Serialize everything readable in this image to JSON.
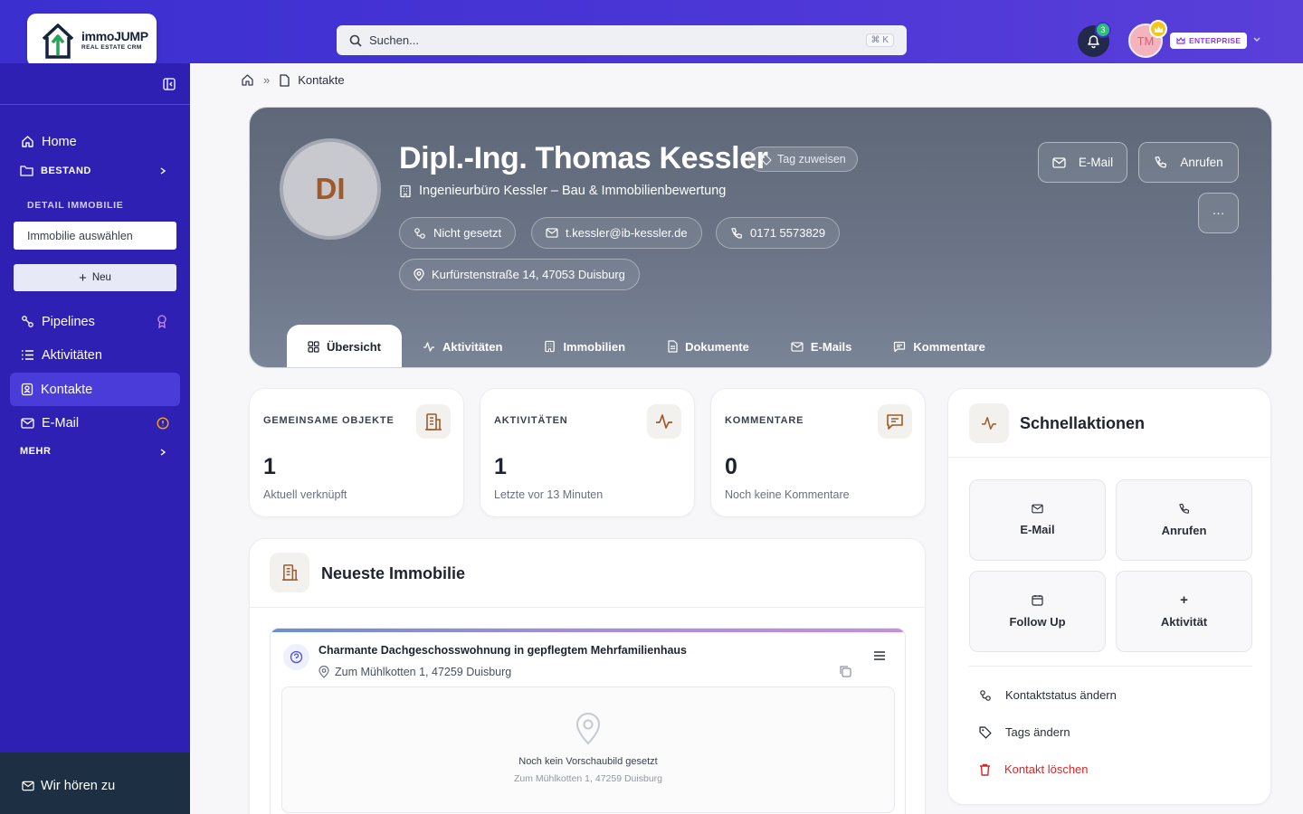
{
  "brand": {
    "name": "immoJUMP",
    "tagline": "REAL ESTATE CRM"
  },
  "search": {
    "placeholder": "Suchen...",
    "shortcut": "⌘ K"
  },
  "header": {
    "notification_count": "3",
    "user_initials": "TM",
    "plan_badge": "ENTERPRISE"
  },
  "sidebar": {
    "home": "Home",
    "bestand": "BESTAND",
    "detail_heading": "DETAIL IMMOBILIE",
    "select_placeholder": "Immobilie auswählen",
    "new_label": "Neu",
    "pipelines": "Pipelines",
    "aktivitaeten": "Aktivitäten",
    "kontakte": "Kontakte",
    "email": "E-Mail",
    "mehr": "MEHR",
    "feedback": "Wir hören zu"
  },
  "breadcrumb": {
    "current": "Kontakte"
  },
  "contact": {
    "initials": "DI",
    "name": "Dipl.-Ing. Thomas Kessler",
    "tag_button": "Tag zuweisen",
    "company": "Ingenieurbüro Kessler – Bau & Immobilienbewertung",
    "status": "Nicht gesetzt",
    "email": "t.kessler@ib-kessler.de",
    "phone": "0171 5573829",
    "address": "Kurfürstenstraße 14, 47053 Duisburg",
    "btn_email": "E-Mail",
    "btn_call": "Anrufen",
    "btn_more": "···"
  },
  "tabs": [
    "Übersicht",
    "Aktivitäten",
    "Immobilien",
    "Dokumente",
    "E-Mails",
    "Kommentare"
  ],
  "stats": [
    {
      "label": "GEMEINSAME OBJEKTE",
      "value": "1",
      "sub": "Aktuell verknüpft"
    },
    {
      "label": "AKTIVITÄTEN",
      "value": "1",
      "sub": "Letzte vor 13 Minuten"
    },
    {
      "label": "KOMMENTARE",
      "value": "0",
      "sub": "Noch keine Kommentare"
    }
  ],
  "latest_property": {
    "section_title": "Neueste Immobilie",
    "title": "Charmante Dachgeschosswohnung in gepflegtem Mehrfamilienhaus",
    "address": "Zum Mühlkotten 1, 47259 Duisburg",
    "no_image": "Noch kein Vorschaubild gesetzt",
    "no_image_addr": "Zum Mühlkotten 1, 47259 Duisburg"
  },
  "quick_actions": {
    "title": "Schnellaktionen",
    "buttons": [
      "E-Mail",
      "Anrufen",
      "Follow Up",
      "Aktivität"
    ],
    "links": [
      "Kontaktstatus ändern",
      "Tags ändern",
      "Kontakt löschen"
    ]
  },
  "colors": {
    "topbar": "#3b2fd0",
    "sidebar": "#2f20b4",
    "accent": "#9e5a2a",
    "danger": "#d62828",
    "badge_green": "#2dbf7a",
    "plan_purple": "#8a3be0"
  }
}
